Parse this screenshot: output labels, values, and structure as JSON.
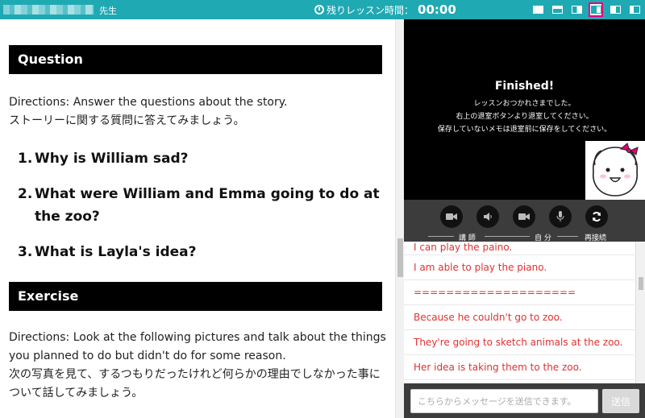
{
  "topbar": {
    "teacher_suffix": "先生",
    "remaining_label": "残りレッスン時間：",
    "remaining_time": "00:00",
    "layout_icons": [
      "layout-full-icon",
      "layout-top-icon",
      "layout-right-icon",
      "layout-split-icon",
      "layout-list-icon",
      "layout-side-icon"
    ]
  },
  "content": {
    "question_heading": "Question",
    "question_directions_en": "Directions: Answer the questions about the story.",
    "question_directions_ja": "ストーリーに関する質問に答えてみましょう。",
    "questions": [
      {
        "num": "1.",
        "text": "Why is William sad?"
      },
      {
        "num": "2.",
        "text": "What were William and Emma going to do at the zoo?"
      },
      {
        "num": "3.",
        "text": "What is Layla's idea?"
      }
    ],
    "exercise_heading": "Exercise",
    "exercise_directions_en": "Directions: Look at the following pictures and talk about the things you planned to do but didn't do for some reason.",
    "exercise_directions_ja": "次の写真を見て、するつもりだったけれど何らかの理由でしなかった事について話してみましょう。"
  },
  "video": {
    "finished_title": "Finished!",
    "message_lines": [
      "レッスンおつかれさまでした。",
      "右上の退室ボタンより退室してください。",
      "保存していないメモは退室前に保存をしてください。"
    ]
  },
  "controls": {
    "teacher_label": "講 師",
    "self_label": "自 分",
    "reconnect_label": "再接続"
  },
  "chat": {
    "messages": [
      "I can play the paino.",
      "I am able to play the piano.",
      "====================",
      "Because he couldn't go to zoo.",
      "They're going to sketch animals at the zoo.",
      "Her idea is taking them to the zoo."
    ],
    "input_placeholder": "こちらからメッセージを送信できます。",
    "send_label": "送信"
  },
  "colors": {
    "accent": "#1fa9b3",
    "highlight": "#e6007e",
    "chat_text": "#e03131"
  }
}
